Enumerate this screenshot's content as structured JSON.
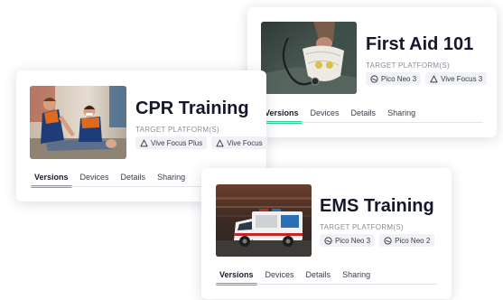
{
  "colors": {
    "accent": "#35c99a",
    "title": "#15172b",
    "chip_bg": "#f1f2f5",
    "muted": "#8a8e9c"
  },
  "platform_label": "TARGET PLATFORM(S)",
  "tabs": [
    "Versions",
    "Devices",
    "Details",
    "Sharing"
  ],
  "cards": {
    "first_aid": {
      "title": "First Aid 101",
      "image_icon": "first-aid-kit-photo",
      "platforms": [
        {
          "label": "Pico Neo 3",
          "icon": "pico-icon"
        },
        {
          "label": "Vive Focus 3",
          "icon": "vive-icon"
        }
      ],
      "active_tab": "Versions"
    },
    "cpr": {
      "title": "CPR Training",
      "image_icon": "cpr-training-photo",
      "platforms": [
        {
          "label": "Vive Focus Plus",
          "icon": "vive-icon"
        },
        {
          "label": "Vive Focus",
          "icon": "vive-icon"
        }
      ],
      "active_tab": "Versions"
    },
    "ems": {
      "title": "EMS Training",
      "image_icon": "ambulance-photo",
      "platforms": [
        {
          "label": "Pico Neo 3",
          "icon": "pico-icon"
        },
        {
          "label": "Pico Neo 2",
          "icon": "pico-icon"
        }
      ],
      "active_tab": "Versions"
    }
  }
}
